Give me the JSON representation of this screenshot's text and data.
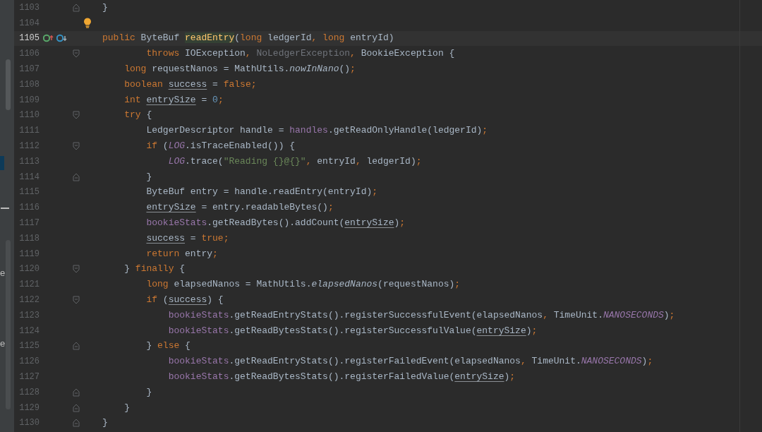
{
  "left_panel": {
    "fragments": [
      "e",
      "e"
    ]
  },
  "editor": {
    "lines": [
      {
        "number": "1103",
        "fold_end": true,
        "tokens": [
          {
            "kind": "plain",
            "text": "}"
          }
        ]
      },
      {
        "number": "1104",
        "bulb": true
      },
      {
        "number": "1105",
        "current": true,
        "gutter_icons": [
          {
            "kind": "implementing"
          },
          {
            "kind": "overridden"
          }
        ],
        "tokens": [
          {
            "kind": "kw",
            "text": "public "
          },
          {
            "kind": "plain",
            "text": "ByteBuf "
          },
          {
            "kind": "decl",
            "text": "readEntry"
          },
          {
            "kind": "plain",
            "text": "("
          },
          {
            "kind": "kw",
            "text": "long "
          },
          {
            "kind": "plain",
            "text": "ledgerId"
          },
          {
            "kind": "punct",
            "text": ", "
          },
          {
            "kind": "kw",
            "text": "long "
          },
          {
            "kind": "plain",
            "text": "entryId)"
          }
        ]
      },
      {
        "number": "1106",
        "fold_start": true,
        "tokens": [
          {
            "kind": "kw",
            "text": "        throws "
          },
          {
            "kind": "plain",
            "text": "IOException"
          },
          {
            "kind": "punct",
            "text": ", "
          },
          {
            "kind": "unused",
            "text": "NoLedgerException"
          },
          {
            "kind": "punct",
            "text": ", "
          },
          {
            "kind": "plain",
            "text": "BookieException {"
          }
        ]
      },
      {
        "number": "1107",
        "tokens": [
          {
            "kind": "kw",
            "text": "    long "
          },
          {
            "kind": "plain",
            "text": "requestNanos = MathUtils."
          },
          {
            "kind": "italic",
            "text": "nowInNano"
          },
          {
            "kind": "plain",
            "text": "()"
          },
          {
            "kind": "punct",
            "text": ";"
          }
        ]
      },
      {
        "number": "1108",
        "tokens": [
          {
            "kind": "kw",
            "text": "    boolean "
          },
          {
            "kind": "var",
            "text": "success"
          },
          {
            "kind": "plain",
            "text": " = "
          },
          {
            "kind": "kw",
            "text": "false"
          },
          {
            "kind": "punct",
            "text": ";"
          }
        ]
      },
      {
        "number": "1109",
        "tokens": [
          {
            "kind": "kw",
            "text": "    int "
          },
          {
            "kind": "var",
            "text": "entrySize"
          },
          {
            "kind": "plain",
            "text": " = "
          },
          {
            "kind": "num",
            "text": "0"
          },
          {
            "kind": "punct",
            "text": ";"
          }
        ]
      },
      {
        "number": "1110",
        "fold_start": true,
        "tokens": [
          {
            "kind": "kw",
            "text": "    try "
          },
          {
            "kind": "plain",
            "text": "{"
          }
        ]
      },
      {
        "number": "1111",
        "tokens": [
          {
            "kind": "plain",
            "text": "        LedgerDescriptor handle = "
          },
          {
            "kind": "field",
            "text": "handles"
          },
          {
            "kind": "plain",
            "text": ".getReadOnlyHandle(ledgerId)"
          },
          {
            "kind": "punct",
            "text": ";"
          }
        ]
      },
      {
        "number": "1112",
        "fold_start": true,
        "tokens": [
          {
            "kind": "kw",
            "text": "        if "
          },
          {
            "kind": "plain",
            "text": "("
          },
          {
            "kind": "static",
            "text": "LOG"
          },
          {
            "kind": "plain",
            "text": ".isTraceEnabled()) {"
          }
        ]
      },
      {
        "number": "1113",
        "tokens": [
          {
            "kind": "static",
            "text": "            LOG"
          },
          {
            "kind": "plain",
            "text": ".trace("
          },
          {
            "kind": "str",
            "text": "\"Reading {}@{}\""
          },
          {
            "kind": "punct",
            "text": ", "
          },
          {
            "kind": "plain",
            "text": "entryId"
          },
          {
            "kind": "punct",
            "text": ", "
          },
          {
            "kind": "plain",
            "text": "ledgerId)"
          },
          {
            "kind": "punct",
            "text": ";"
          }
        ]
      },
      {
        "number": "1114",
        "fold_end": true,
        "tokens": [
          {
            "kind": "plain",
            "text": "        }"
          }
        ]
      },
      {
        "number": "1115",
        "tokens": [
          {
            "kind": "plain",
            "text": "        ByteBuf entry = handle.readEntry(entryId)"
          },
          {
            "kind": "punct",
            "text": ";"
          }
        ]
      },
      {
        "number": "1116",
        "tokens": [
          {
            "kind": "var",
            "text": "        entrySize"
          },
          {
            "kind": "plain",
            "text": " = entry.readableBytes()"
          },
          {
            "kind": "punct",
            "text": ";"
          }
        ]
      },
      {
        "number": "1117",
        "tokens": [
          {
            "kind": "field",
            "text": "        bookieStats"
          },
          {
            "kind": "plain",
            "text": ".getReadBytes().addCount("
          },
          {
            "kind": "var",
            "text": "entrySize"
          },
          {
            "kind": "plain",
            "text": ")"
          },
          {
            "kind": "punct",
            "text": ";"
          }
        ]
      },
      {
        "number": "1118",
        "tokens": [
          {
            "kind": "var",
            "text": "        success"
          },
          {
            "kind": "plain",
            "text": " = "
          },
          {
            "kind": "kw",
            "text": "true"
          },
          {
            "kind": "punct",
            "text": ";"
          }
        ]
      },
      {
        "number": "1119",
        "tokens": [
          {
            "kind": "kw",
            "text": "        return "
          },
          {
            "kind": "plain",
            "text": "entry"
          },
          {
            "kind": "punct",
            "text": ";"
          }
        ]
      },
      {
        "number": "1120",
        "fold_start": true,
        "tokens": [
          {
            "kind": "plain",
            "text": "    } "
          },
          {
            "kind": "kw",
            "text": "finally "
          },
          {
            "kind": "plain",
            "text": "{"
          }
        ]
      },
      {
        "number": "1121",
        "tokens": [
          {
            "kind": "kw",
            "text": "        long "
          },
          {
            "kind": "plain",
            "text": "elapsedNanos = MathUtils."
          },
          {
            "kind": "italic",
            "text": "elapsedNanos"
          },
          {
            "kind": "plain",
            "text": "(requestNanos)"
          },
          {
            "kind": "punct",
            "text": ";"
          }
        ]
      },
      {
        "number": "1122",
        "fold_start": true,
        "tokens": [
          {
            "kind": "kw",
            "text": "        if "
          },
          {
            "kind": "plain",
            "text": "("
          },
          {
            "kind": "var",
            "text": "success"
          },
          {
            "kind": "plain",
            "text": ") {"
          }
        ]
      },
      {
        "number": "1123",
        "tokens": [
          {
            "kind": "field",
            "text": "            bookieStats"
          },
          {
            "kind": "plain",
            "text": ".getReadEntryStats().registerSuccessfulEvent(elapsedNanos"
          },
          {
            "kind": "punct",
            "text": ", "
          },
          {
            "kind": "plain",
            "text": "TimeUnit."
          },
          {
            "kind": "static",
            "text": "NANOSECONDS"
          },
          {
            "kind": "plain",
            "text": ")"
          },
          {
            "kind": "punct",
            "text": ";"
          }
        ]
      },
      {
        "number": "1124",
        "tokens": [
          {
            "kind": "field",
            "text": "            bookieStats"
          },
          {
            "kind": "plain",
            "text": ".getReadBytesStats().registerSuccessfulValue("
          },
          {
            "kind": "var",
            "text": "entrySize"
          },
          {
            "kind": "plain",
            "text": ")"
          },
          {
            "kind": "punct",
            "text": ";"
          }
        ]
      },
      {
        "number": "1125",
        "fold_end": true,
        "tokens": [
          {
            "kind": "plain",
            "text": "        } "
          },
          {
            "kind": "kw",
            "text": "else "
          },
          {
            "kind": "plain",
            "text": "{"
          }
        ]
      },
      {
        "number": "1126",
        "tokens": [
          {
            "kind": "field",
            "text": "            bookieStats"
          },
          {
            "kind": "plain",
            "text": ".getReadEntryStats().registerFailedEvent(elapsedNanos"
          },
          {
            "kind": "punct",
            "text": ", "
          },
          {
            "kind": "plain",
            "text": "TimeUnit."
          },
          {
            "kind": "static",
            "text": "NANOSECONDS"
          },
          {
            "kind": "plain",
            "text": ")"
          },
          {
            "kind": "punct",
            "text": ";"
          }
        ]
      },
      {
        "number": "1127",
        "tokens": [
          {
            "kind": "field",
            "text": "            bookieStats"
          },
          {
            "kind": "plain",
            "text": ".getReadBytesStats().registerFailedValue("
          },
          {
            "kind": "var",
            "text": "entrySize"
          },
          {
            "kind": "plain",
            "text": ")"
          },
          {
            "kind": "punct",
            "text": ";"
          }
        ]
      },
      {
        "number": "1128",
        "fold_end": true,
        "tokens": [
          {
            "kind": "plain",
            "text": "        }"
          }
        ]
      },
      {
        "number": "1129",
        "fold_end": true,
        "tokens": [
          {
            "kind": "plain",
            "text": "    }"
          }
        ]
      },
      {
        "number": "1130",
        "fold_end": true,
        "tokens": [
          {
            "kind": "plain",
            "text": "}"
          }
        ]
      }
    ]
  }
}
